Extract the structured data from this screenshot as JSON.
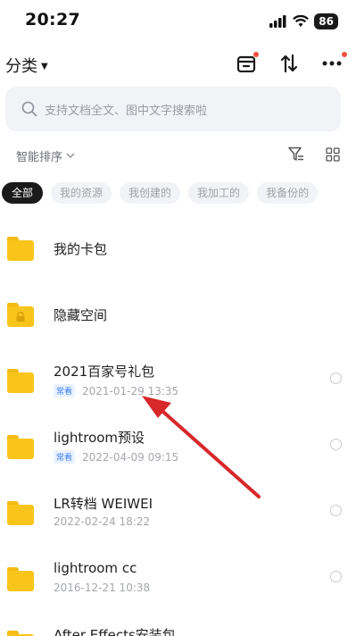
{
  "status": {
    "time": "20:27",
    "battery": "86"
  },
  "nav": {
    "category": "分类",
    "icons": [
      "transfer-box-icon",
      "sort-arrows-icon",
      "more-icon"
    ]
  },
  "search": {
    "placeholder": "支持文档全文、图中文字搜索啦"
  },
  "sort": {
    "label": "智能排序"
  },
  "chips": [
    "全部",
    "我的资源",
    "我创建的",
    "我加工的",
    "我备份的"
  ],
  "files": [
    {
      "name": "我的卡包",
      "badge": "",
      "date": ""
    },
    {
      "name": "隐藏空间",
      "badge": "",
      "date": ""
    },
    {
      "name": "2021百家号礼包",
      "badge": "常看",
      "date": "2021-01-29 13:35"
    },
    {
      "name": "lightroom预设",
      "badge": "常看",
      "date": "2022-04-09 09:15"
    },
    {
      "name": "LR转档   WEIWEI",
      "badge": "",
      "date": "2022-02-24 18:22"
    },
    {
      "name": "lightroom cc",
      "badge": "",
      "date": "2016-12-21 10:38"
    },
    {
      "name": "After Effects安装包",
      "badge": "",
      "date": ""
    }
  ],
  "colors": {
    "accent_red": "#d8282a",
    "folder": "#f9c51b",
    "badge_blue": "#3b7ff0"
  }
}
